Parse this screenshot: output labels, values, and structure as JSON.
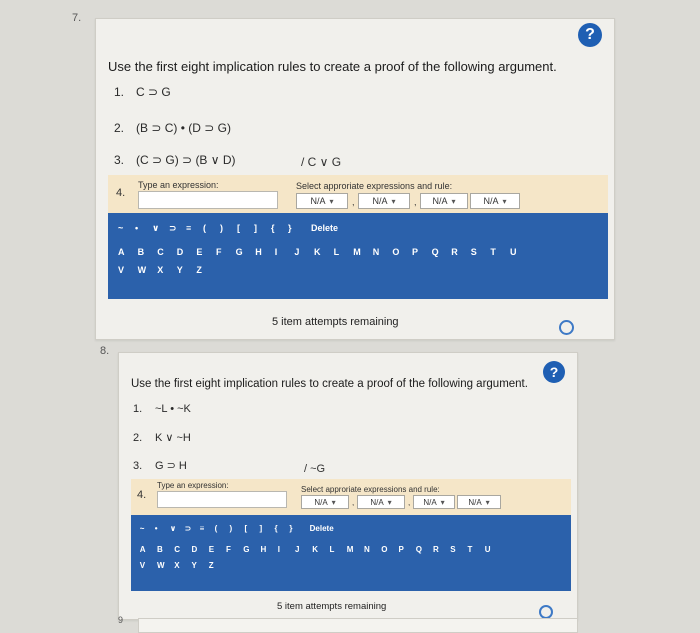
{
  "q7": {
    "number": "7.",
    "help": "?",
    "instruction": "Use the first eight implication rules to create a proof of the following argument.",
    "premises": [
      {
        "n": "1.",
        "text": "C ⊃ G"
      },
      {
        "n": "2.",
        "text": "(B ⊃ C) • (D ⊃ G)"
      },
      {
        "n": "3.",
        "text": "(C ⊃ G) ⊃ (B ∨ D)"
      }
    ],
    "conclusion": "/ C ∨ G",
    "entry_num": "4.",
    "type_label": "Type an expression:",
    "select_label": "Select approriate expressions and rule:",
    "selects": [
      "N/A",
      "N/A",
      "N/A",
      "N/A"
    ],
    "commas": [
      ",",
      ","
    ],
    "symbols": [
      "~",
      "•",
      "∨",
      "⊃",
      "≡",
      "(",
      ")",
      "[",
      "]",
      "{",
      "}",
      "Delete"
    ],
    "letters_row1": [
      "A",
      "B",
      "C",
      "D",
      "E",
      "F",
      "G",
      "H",
      "I",
      "J",
      "K",
      "L",
      "M",
      "N",
      "O",
      "P",
      "Q",
      "R",
      "S",
      "T",
      "U"
    ],
    "letters_row2": [
      "V",
      "W",
      "X",
      "Y",
      "Z"
    ],
    "attempts": "5 item attempts remaining"
  },
  "q8": {
    "number": "8.",
    "help": "?",
    "instruction": "Use the first eight implication rules to create a proof of the following argument.",
    "premises": [
      {
        "n": "1.",
        "text": "~L • ~K"
      },
      {
        "n": "2.",
        "text": "K ∨ ~H"
      },
      {
        "n": "3.",
        "text": "G ⊃ H"
      }
    ],
    "conclusion": "/ ~G",
    "entry_num": "4.",
    "type_label": "Type an expression:",
    "select_label": "Select approriate expressions and rule:",
    "selects": [
      "N/A",
      "N/A",
      "N/A",
      "N/A"
    ],
    "commas": [
      ",",
      ","
    ],
    "symbols": [
      "~",
      "•",
      "∨",
      "⊃",
      "≡",
      "(",
      ")",
      "[",
      "]",
      "{",
      "}",
      "Delete"
    ],
    "letters_row1": [
      "A",
      "B",
      "C",
      "D",
      "E",
      "F",
      "G",
      "H",
      "I",
      "J",
      "K",
      "L",
      "M",
      "N",
      "O",
      "P",
      "Q",
      "R",
      "S",
      "T",
      "U"
    ],
    "letters_row2": [
      "V",
      "W",
      "X",
      "Y",
      "Z"
    ],
    "attempts": "5 item attempts remaining"
  },
  "q9": {
    "number": "9"
  },
  "colors": {
    "keyboard": "#2b61ab",
    "help": "#1f5fb3",
    "entry_band": "#f5e6c8",
    "circle": "#3d79c6"
  }
}
